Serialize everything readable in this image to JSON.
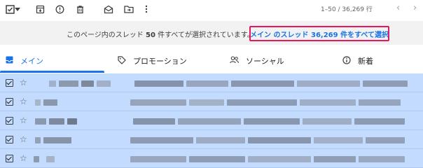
{
  "toolbar": {
    "pager_text": "1–50 / 36,269 行",
    "icons": [
      "select-all-checkbox-icon",
      "dropdown-icon",
      "archive-icon",
      "report-spam-icon",
      "delete-icon",
      "mark-unread-icon",
      "move-to-icon",
      "more-icon"
    ],
    "prev_arrow": "‹",
    "next_arrow": "›"
  },
  "banner": {
    "prefix": "このページ内のスレッド",
    "count": "50",
    "suffix": "件すべてが選択されています。",
    "select_all_link": "メイン のスレッド 36,269 件をすべて選択",
    "highlight_color": "#e8175d",
    "link_color": "#1a73e8"
  },
  "tabs": [
    {
      "label": "メイン",
      "icon": "inbox-icon",
      "active": true
    },
    {
      "label": "プロモーション",
      "icon": "tag-icon",
      "active": false
    },
    {
      "label": "ソーシャル",
      "icon": "people-icon",
      "active": false
    },
    {
      "label": "新着",
      "icon": "info-icon",
      "active": false
    }
  ],
  "rows": [
    {
      "selected": true,
      "starred": false
    },
    {
      "selected": true,
      "starred": false
    },
    {
      "selected": true,
      "starred": false
    },
    {
      "selected": true,
      "starred": false
    },
    {
      "selected": true,
      "starred": false
    }
  ],
  "colors": {
    "selected_row_bg": "#c2dbff",
    "accent": "#1a73e8"
  }
}
